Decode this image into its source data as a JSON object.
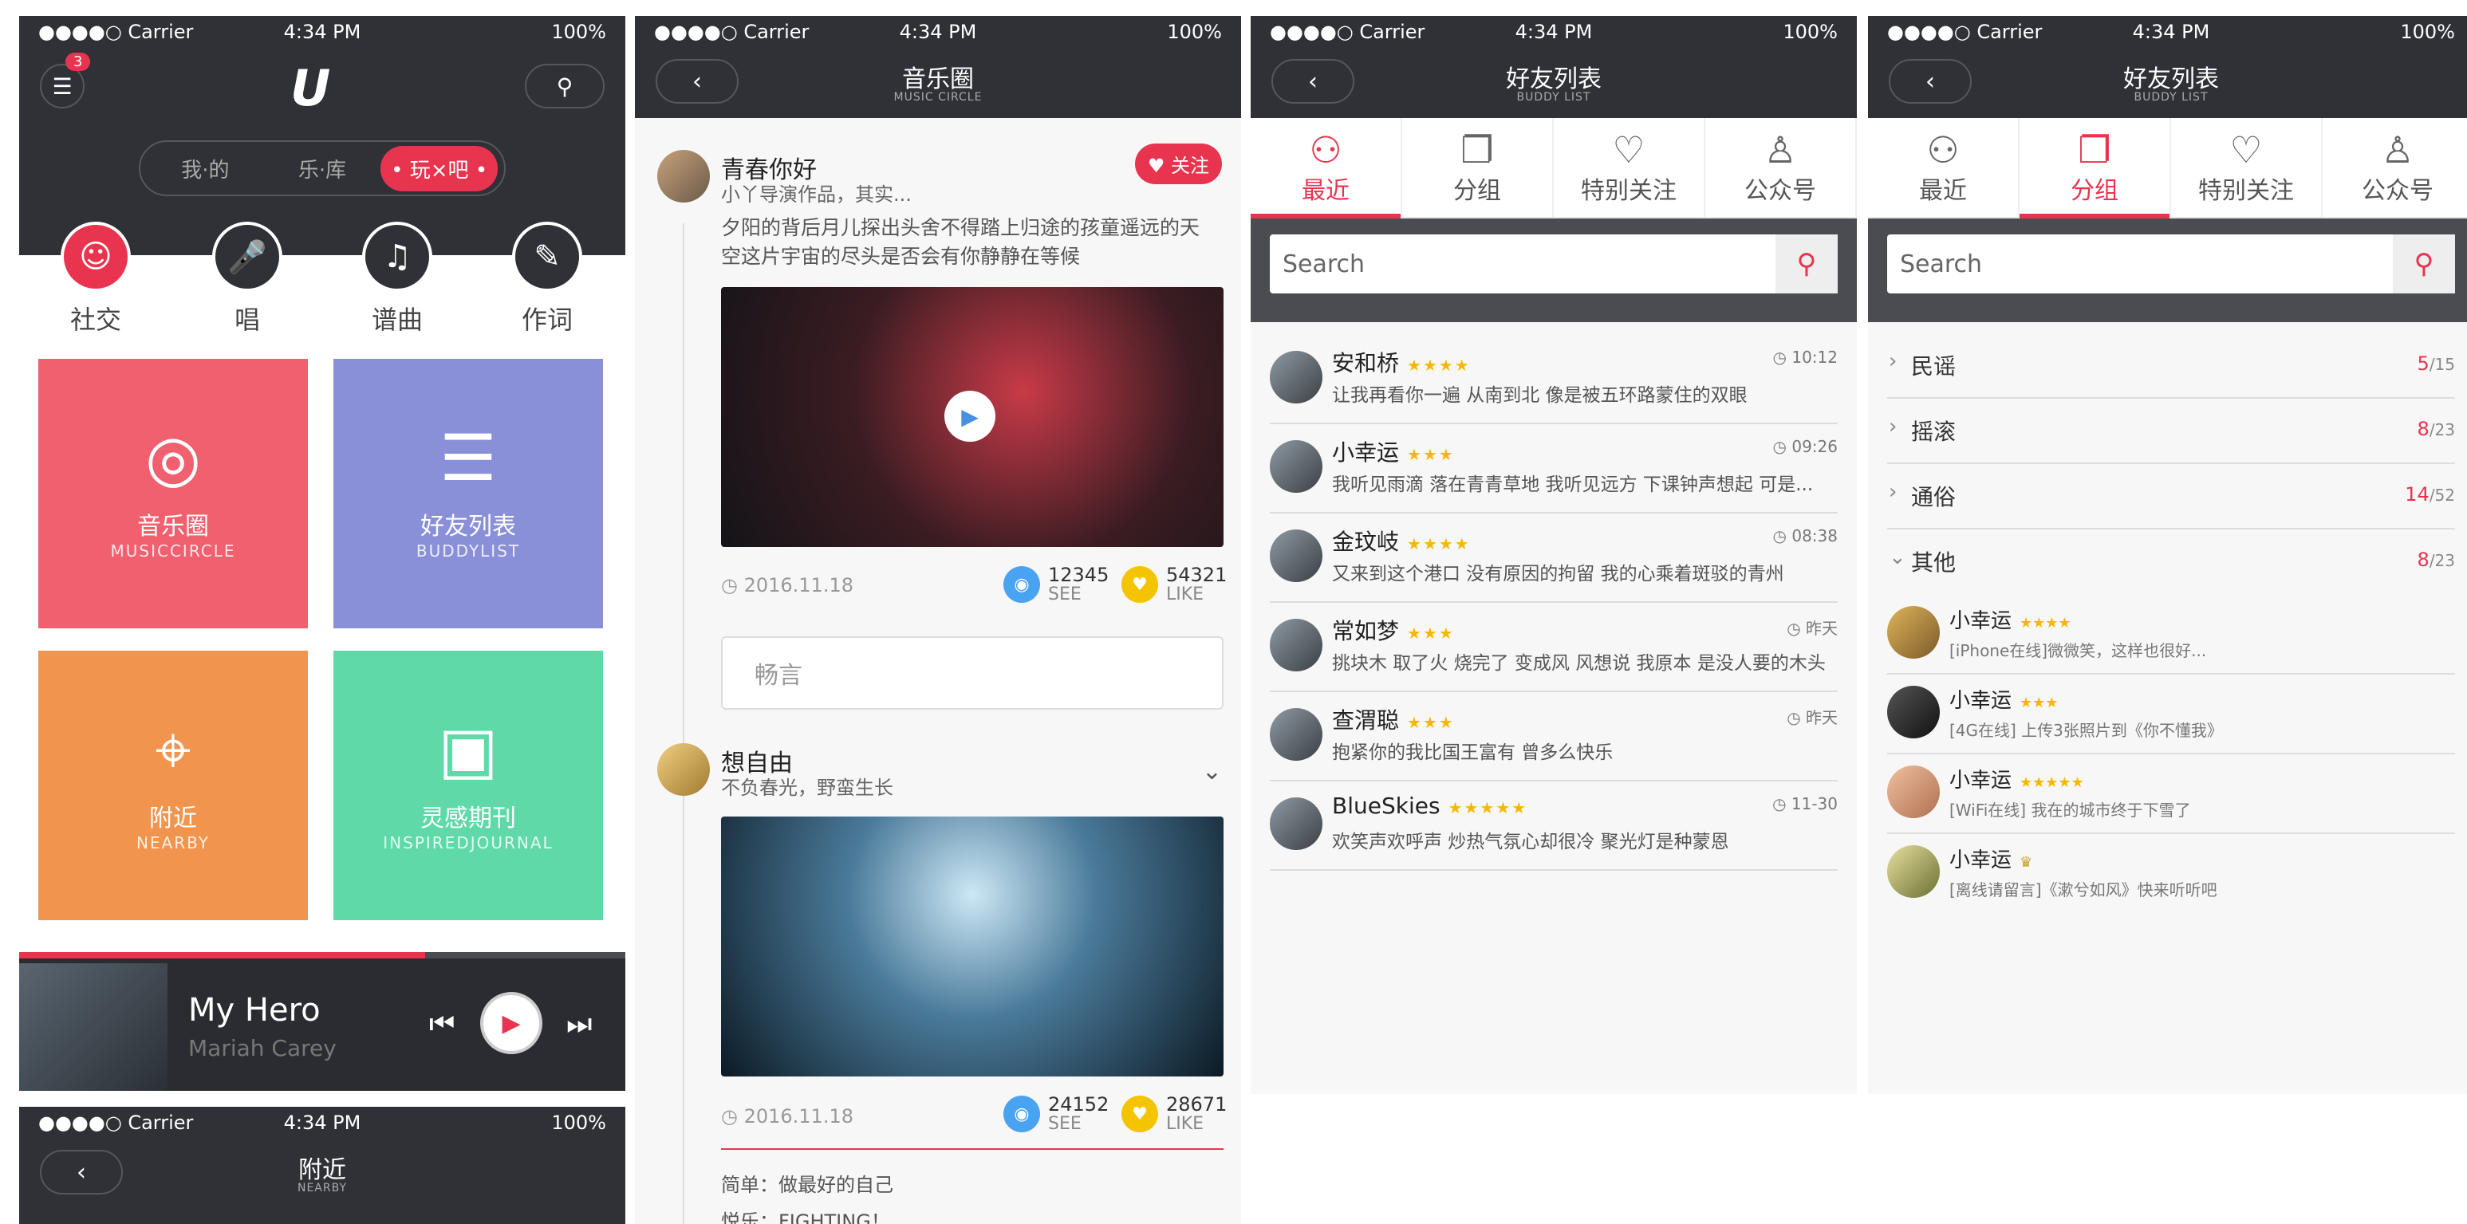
{
  "status": {
    "carrier": "●●●●○ Carrier",
    "time": "4:34 PM",
    "battery": "100%"
  },
  "colors": {
    "accent": "#e8344e",
    "dark": "#2f3136",
    "star": "#f5b800"
  },
  "home": {
    "badge": "3",
    "logo": "U",
    "segments": [
      "我·的",
      "乐·库",
      "• 玩×吧 •"
    ],
    "categories": [
      "社交",
      "唱",
      "谱曲",
      "作词"
    ],
    "tiles": [
      {
        "title": "音乐圈",
        "subtitle": "MUSICCIRCLE",
        "color": "#f0606e",
        "icon": "circle-icon"
      },
      {
        "title": "好友列表",
        "subtitle": "BUDDYLIST",
        "color": "#8a90d8",
        "icon": "list-icon"
      },
      {
        "title": "附近",
        "subtitle": "NEARBY",
        "color": "#f0944e",
        "icon": "location-icon"
      },
      {
        "title": "灵感期刊",
        "subtitle": "INSPIREDJOURNAL",
        "color": "#5fd9a8",
        "icon": "book-icon"
      }
    ],
    "player": {
      "title": "My Hero",
      "artist": "Mariah Carey",
      "progress": 0.67
    },
    "nearby_title": "附近",
    "nearby_sub": "NEARBY"
  },
  "circle": {
    "title": "音乐圈",
    "subtitle": "MUSIC CIRCLE",
    "post1": {
      "name": "青春你好",
      "desc": "小丫导演作品，其实...",
      "follow": "关注",
      "text": "夕阳的背后月儿探出头舍不得踏上归途的孩童遥远的天空这片宇宙的尽头是否会有你静静在等候",
      "date": "2016.11.18",
      "see": "12345",
      "see_label": "SEE",
      "like": "54321",
      "like_label": "LIKE"
    },
    "comment_placeholder": "畅言",
    "post2": {
      "name": "想自由",
      "desc": "不负春光，野蛮生长",
      "date": "2016.11.18",
      "see": "24152",
      "see_label": "SEE",
      "like": "28671",
      "like_label": "LIKE",
      "line1": "简单：做最好的自己",
      "line2": "悦乐：FIGHTING！"
    }
  },
  "buddy": {
    "title": "好友列表",
    "subtitle": "BUDDY LIST",
    "tabs": [
      "最近",
      "分组",
      "特别关注",
      "公众号"
    ],
    "search_placeholder": "Search",
    "recent": [
      {
        "name": "安和桥",
        "stars": "★★★★",
        "time": "10:12",
        "msg": "让我再看你一遍 从南到北 像是被五环路蒙住的双眼"
      },
      {
        "name": "小幸运",
        "stars": "★★★",
        "time": "09:26",
        "msg": "我听见雨滴 落在青青草地 我听见远方 下课钟声想起 可是..."
      },
      {
        "name": "金玟岐",
        "stars": "★★★★",
        "time": "08:38",
        "msg": "又来到这个港口 没有原因的拘留 我的心乘着斑驳的青州"
      },
      {
        "name": "常如梦",
        "stars": "★★★",
        "time": "昨天",
        "msg": "挑块木 取了火 烧完了 变成风 风想说 我原本 是没人要的木头"
      },
      {
        "name": "查渭聪",
        "stars": "★★★",
        "time": "昨天",
        "msg": "抱紧你的我比国王富有 曾多么快乐"
      },
      {
        "name": "BlueSkies",
        "stars": "★★★★★",
        "time": "11-30",
        "msg": "欢笑声欢呼声 炒热气氛心却很冷 聚光灯是种蒙恩"
      }
    ],
    "groups": [
      {
        "name": "民谣",
        "online": "5",
        "total": "/15"
      },
      {
        "name": "摇滚",
        "online": "8",
        "total": "/23"
      },
      {
        "name": "通俗",
        "online": "14",
        "total": "/52"
      },
      {
        "name": "其他",
        "online": "8",
        "total": "/23"
      }
    ],
    "members": [
      {
        "name": "小幸运",
        "stars": "★★★★",
        "msg": "[iPhone在线]微微笑，这样也很好..."
      },
      {
        "name": "小幸运",
        "stars": "★★★",
        "msg": "[4G在线] 上传3张照片到《你不懂我》"
      },
      {
        "name": "小幸运",
        "stars": "★★★★★",
        "msg": "[WiFi在线] 我在的城市终于下雪了"
      },
      {
        "name": "小幸运",
        "stars": "♛",
        "msg": "[离线请留言]《漱兮如风》快来听听吧"
      }
    ]
  }
}
